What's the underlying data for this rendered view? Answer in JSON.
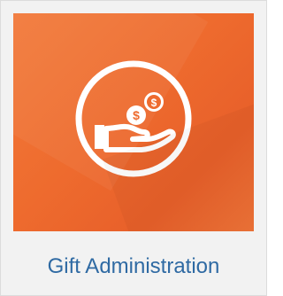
{
  "card": {
    "title": "Gift Administration",
    "icon": "hand-receiving-coins-icon",
    "colors": {
      "tile": "#ee6b2e",
      "label": "#2f6aa3",
      "icon_stroke": "#ffffff"
    }
  },
  "coins": [
    {
      "symbol": "$"
    },
    {
      "symbol": "$"
    }
  ]
}
